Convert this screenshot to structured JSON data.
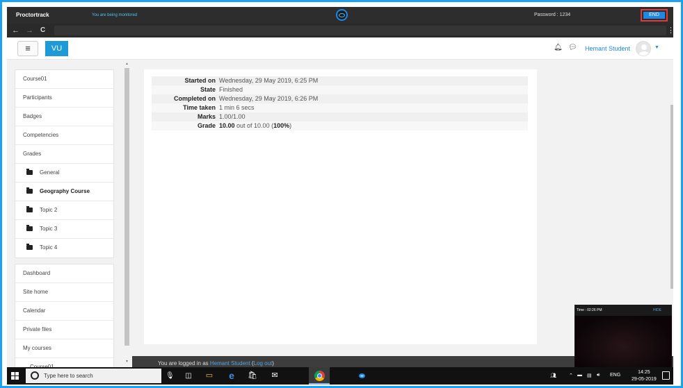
{
  "proctor": {
    "title": "Proctortrack",
    "monitor_text": "You are being monitored",
    "password_text": "Password : 1234",
    "end_label": "END"
  },
  "browser": {
    "back": "←",
    "forward": "→",
    "reload": "C",
    "menu": "⋮"
  },
  "header": {
    "menu_toggle": "≡",
    "brand": "VU",
    "user_name": "Hemant Student"
  },
  "sidebar": {
    "course_nav": [
      {
        "label": "Course01"
      },
      {
        "label": "Participants"
      },
      {
        "label": "Badges"
      },
      {
        "label": "Competencies"
      },
      {
        "label": "Grades"
      },
      {
        "label": "General"
      },
      {
        "label": "Geography Course"
      },
      {
        "label": "Topic 2"
      },
      {
        "label": "Topic 3"
      },
      {
        "label": "Topic 4"
      }
    ],
    "site_nav": [
      {
        "label": "Dashboard"
      },
      {
        "label": "Site home"
      },
      {
        "label": "Calendar"
      },
      {
        "label": "Private files"
      },
      {
        "label": "My courses"
      },
      {
        "label": "Course01"
      }
    ]
  },
  "quiz_summary": {
    "rows": [
      {
        "label": "Started on",
        "value": "Wednesday, 29 May 2019, 6:25 PM"
      },
      {
        "label": "State",
        "value": "Finished"
      },
      {
        "label": "Completed on",
        "value": "Wednesday, 29 May 2019, 6:26 PM"
      },
      {
        "label": "Time taken",
        "value": "1 min 6 secs"
      },
      {
        "label": "Marks",
        "value": "1.00/1.00"
      }
    ],
    "grade": {
      "label": "Grade",
      "score": "10.00",
      "out_of": " out of 10.00 (",
      "percent": "100%",
      "close": ")"
    }
  },
  "footer": {
    "logged_in_prefix": "You are logged in as ",
    "user_link": "Hemant Student",
    "open_paren": " (",
    "logout_link": "Log out",
    "close_paren": ")"
  },
  "camera": {
    "time_text": "Time : 02:26 PM",
    "hide_label": "HIDE"
  },
  "taskbar": {
    "search_placeholder": "Type here to search",
    "lang": "ENG",
    "time": "14:25",
    "date": "29-05-2019"
  },
  "colors": {
    "accent": "#1e9ad6",
    "frame": "#1da1f2",
    "end_button": "#1e88e5",
    "end_highlight": "#e53935"
  }
}
